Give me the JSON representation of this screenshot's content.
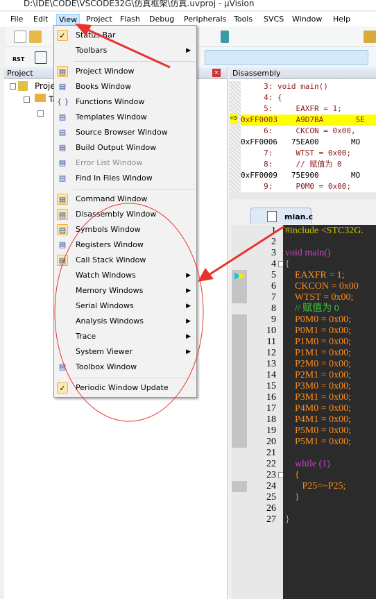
{
  "title": "D:\\IDE\\CODE\\VSCODE32G\\仿真框架\\仿真.uvproj - µVision",
  "menubar": [
    "File",
    "Edit",
    "View",
    "Project",
    "Flash",
    "Debug",
    "Peripherals",
    "Tools",
    "SVCS",
    "Window",
    "Help"
  ],
  "active_menu": "View",
  "project_panel": {
    "title": "Project",
    "root": "Proje",
    "child": "Ta"
  },
  "disassembly": {
    "title": "Disassembly",
    "lines": [
      {
        "t": "src",
        "text": "     3: void main()"
      },
      {
        "t": "src",
        "text": "     4: {"
      },
      {
        "t": "src",
        "text": "     5:     EAXFR = 1;"
      },
      {
        "t": "cur",
        "text": "0xFF0003    A9D7BA       SE"
      },
      {
        "t": "src",
        "text": "     6:     CKCON = 0x00,"
      },
      {
        "t": "asm",
        "text": "0xFF0006   75EA00       MO"
      },
      {
        "t": "src",
        "text": "     7:     WTST = 0x00;"
      },
      {
        "t": "src",
        "text": "     8:     // 赋值为 0 "
      },
      {
        "t": "asm",
        "text": "0xFF0009   75E900       MO"
      },
      {
        "t": "src",
        "text": "     9:     P0M0 = 0x00;"
      }
    ]
  },
  "editor": {
    "tab": "mian.c",
    "lines": [
      "#include <STC32G.",
      "",
      "void main()",
      "{",
      "    EAXFR = 1;",
      "    CKCON = 0x00",
      "    WTST = 0x00;",
      "    // 赋值为 0",
      "    P0M0 = 0x00;",
      "    P0M1 = 0x00;",
      "    P1M0 = 0x00;",
      "    P1M1 = 0x00;",
      "    P2M0 = 0x00;",
      "    P2M1 = 0x00;",
      "    P3M0 = 0x00;",
      "    P3M1 = 0x00;",
      "    P4M0 = 0x00;",
      "    P4M1 = 0x00;",
      "    P5M0 = 0x00;",
      "    P5M1 = 0x00;",
      "",
      "    while (1)",
      "    {",
      "       P25=~P25;",
      "    }",
      "",
      "}"
    ]
  },
  "view_menu": [
    {
      "label": "Status Bar",
      "icon": "check-icon",
      "checked": true
    },
    {
      "label": "Toolbars",
      "submenu": true
    },
    {
      "sep": true
    },
    {
      "label": "Project Window",
      "icon": "project-window-icon",
      "checked": true
    },
    {
      "label": "Books Window",
      "icon": "books-icon"
    },
    {
      "label": "Functions Window",
      "icon": "braces-icon"
    },
    {
      "label": "Templates Window",
      "icon": "templates-icon"
    },
    {
      "label": "Source Browser Window",
      "icon": "source-browser-icon"
    },
    {
      "label": "Build Output Window",
      "icon": "build-output-icon"
    },
    {
      "label": "Error List Window",
      "icon": "error-list-icon",
      "disabled": true
    },
    {
      "label": "Find In Files Window",
      "icon": "find-in-files-icon"
    },
    {
      "sep": true
    },
    {
      "label": "Command Window",
      "icon": "command-icon",
      "checked": true
    },
    {
      "label": "Disassembly Window",
      "icon": "disassembly-icon",
      "checked": true
    },
    {
      "label": "Symbols Window",
      "icon": "symbols-icon",
      "checked": true
    },
    {
      "label": "Registers Window",
      "icon": "registers-icon"
    },
    {
      "label": "Call Stack Window",
      "icon": "call-stack-icon",
      "checked": true
    },
    {
      "label": "Watch Windows",
      "submenu": true
    },
    {
      "label": "Memory Windows",
      "submenu": true
    },
    {
      "label": "Serial Windows",
      "submenu": true
    },
    {
      "label": "Analysis Windows",
      "submenu": true
    },
    {
      "label": "Trace",
      "submenu": true
    },
    {
      "label": "System Viewer",
      "submenu": true
    },
    {
      "label": "Toolbox Window",
      "icon": "toolbox-icon"
    },
    {
      "sep": true
    },
    {
      "label": "Periodic Window Update",
      "icon": "check-icon",
      "checked": true
    }
  ],
  "colors": {
    "annotation": "#e8322c",
    "highlight": "#ffff00",
    "menu_active": "#cce8ff"
  }
}
